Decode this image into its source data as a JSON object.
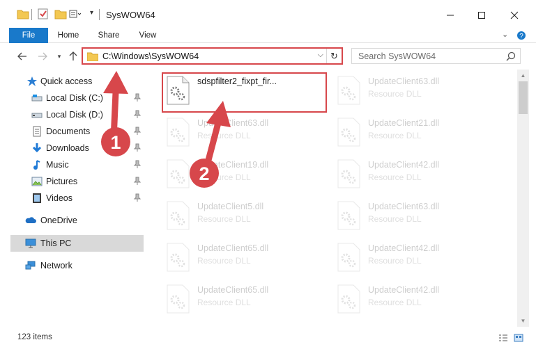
{
  "window": {
    "title": "SysWOW64",
    "minimize_label": "Minimize",
    "maximize_label": "Maximize",
    "close_label": "Close"
  },
  "ribbon": {
    "tabs": [
      {
        "label": "File",
        "active": true
      },
      {
        "label": "Home"
      },
      {
        "label": "Share"
      },
      {
        "label": "View"
      }
    ]
  },
  "address": {
    "path": "C:\\Windows\\SysWOW64",
    "search_placeholder": "Search SysWOW64"
  },
  "sidebar": {
    "items": [
      {
        "label": "Quick access",
        "icon": "star-icon",
        "pinned": false
      },
      {
        "label": "Local Disk (C:)",
        "icon": "drive-icon",
        "pinned": true
      },
      {
        "label": "Local Disk (D:)",
        "icon": "drive-icon",
        "pinned": true
      },
      {
        "label": "Documents",
        "icon": "documents-icon",
        "pinned": true
      },
      {
        "label": "Downloads",
        "icon": "download-icon",
        "pinned": true
      },
      {
        "label": "Music",
        "icon": "music-icon",
        "pinned": true
      },
      {
        "label": "Pictures",
        "icon": "pictures-icon",
        "pinned": true
      },
      {
        "label": "Videos",
        "icon": "videos-icon",
        "pinned": true
      },
      {
        "label": "OneDrive",
        "icon": "cloud-icon"
      },
      {
        "label": "This PC",
        "icon": "computer-icon",
        "selected": true
      },
      {
        "label": "Network",
        "icon": "network-icon"
      }
    ]
  },
  "files": {
    "left": [
      {
        "name": "sdspfilter2_fixpt_fir...",
        "type": ""
      },
      {
        "name": "UpdateClient63.dll",
        "type": "Resource DLL"
      },
      {
        "name": "UpdateClient19.dll",
        "type": "Resource DLL"
      },
      {
        "name": "UpdateClient5.dll",
        "type": "Resource DLL"
      },
      {
        "name": "UpdateClient65.dll",
        "type": "Resource DLL"
      },
      {
        "name": "UpdateClient65.dll",
        "type": "Resource DLL"
      }
    ],
    "right": [
      {
        "name": "UpdateClient63.dll",
        "type": "Resource DLL"
      },
      {
        "name": "UpdateClient21.dll",
        "type": "Resource DLL"
      },
      {
        "name": "UpdateClient42.dll",
        "type": "Resource DLL"
      },
      {
        "name": "UpdateClient63.dll",
        "type": "Resource DLL"
      },
      {
        "name": "UpdateClient42.dll",
        "type": "Resource DLL"
      },
      {
        "name": "UpdateClient42.dll",
        "type": "Resource DLL"
      }
    ]
  },
  "status": {
    "item_count": "123 items"
  },
  "annotations": {
    "step1": "1",
    "step2": "2",
    "color": "#d7474b"
  }
}
